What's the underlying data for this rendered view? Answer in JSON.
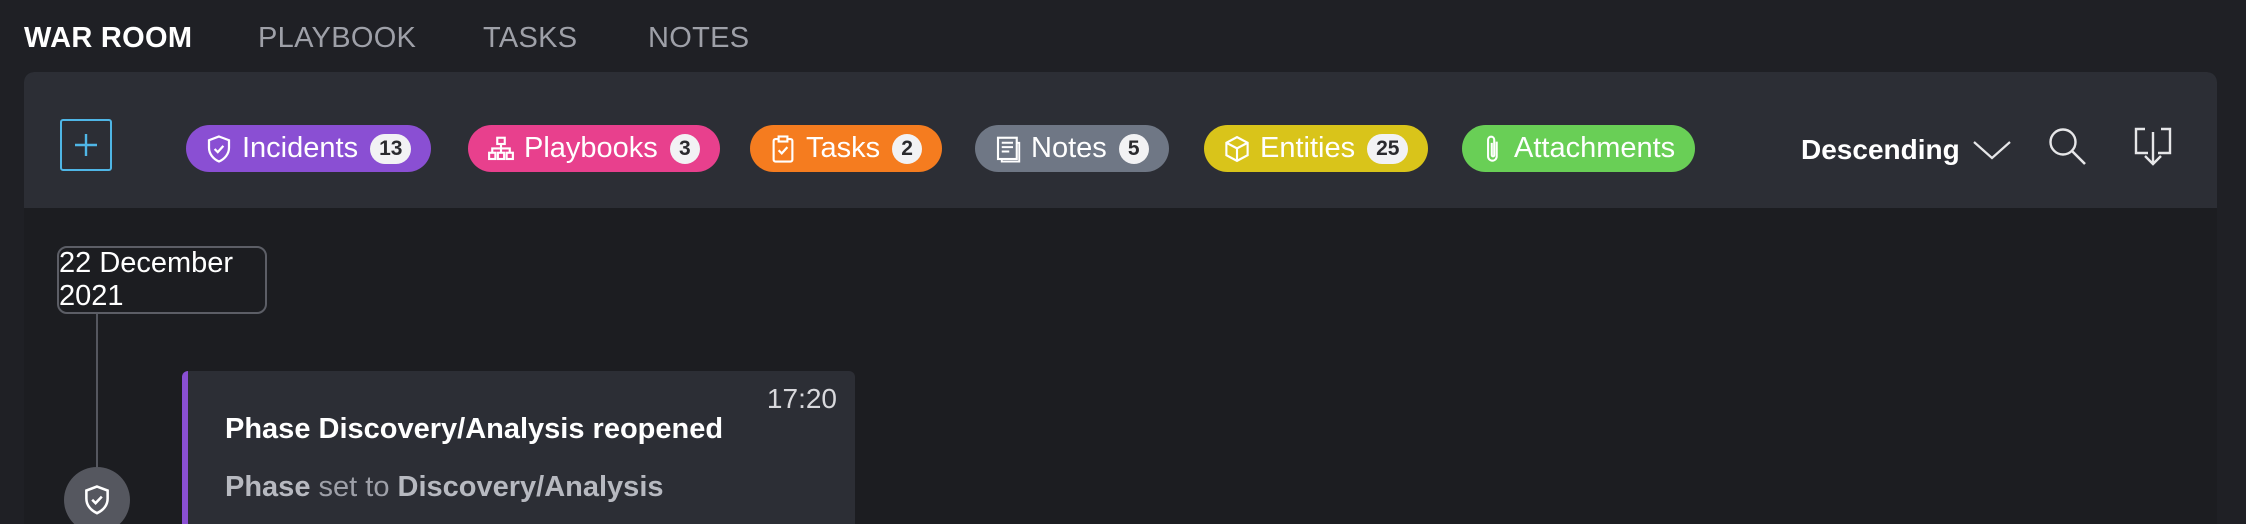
{
  "tabs": [
    {
      "label": "WAR ROOM",
      "active": true
    },
    {
      "label": "PLAYBOOK",
      "active": false
    },
    {
      "label": "TASKS",
      "active": false
    },
    {
      "label": "NOTES",
      "active": false
    }
  ],
  "toolbar": {
    "add_icon": "plus-icon",
    "filters": [
      {
        "label": "Incidents",
        "count": "13",
        "color": "#8a4fd3",
        "icon": "shield-icon"
      },
      {
        "label": "Playbooks",
        "count": "3",
        "color": "#e8408d",
        "icon": "hierarchy-icon"
      },
      {
        "label": "Tasks",
        "count": "2",
        "color": "#f57c1f",
        "icon": "clipboard-icon"
      },
      {
        "label": "Notes",
        "count": "5",
        "color": "#6f7785",
        "icon": "note-icon"
      },
      {
        "label": "Entities",
        "count": "25",
        "color": "#d9c41a",
        "icon": "cube-icon"
      },
      {
        "label": "Attachments",
        "count": "",
        "color": "#69cf56",
        "icon": "paperclip-icon"
      }
    ],
    "sort_label": "Descending",
    "sort_icon": "chevron-down-icon",
    "search_icon": "search-icon",
    "download_icon": "download-icon"
  },
  "timeline": {
    "date": "22 December 2021",
    "node_icon": "shield-icon",
    "events": [
      {
        "time": "17:20",
        "title": "Phase Discovery/Analysis reopened",
        "desc_field": "Phase",
        "desc_middle": "set to",
        "desc_value": "Discovery/Analysis",
        "accent": "#8a4fd3"
      }
    ]
  }
}
